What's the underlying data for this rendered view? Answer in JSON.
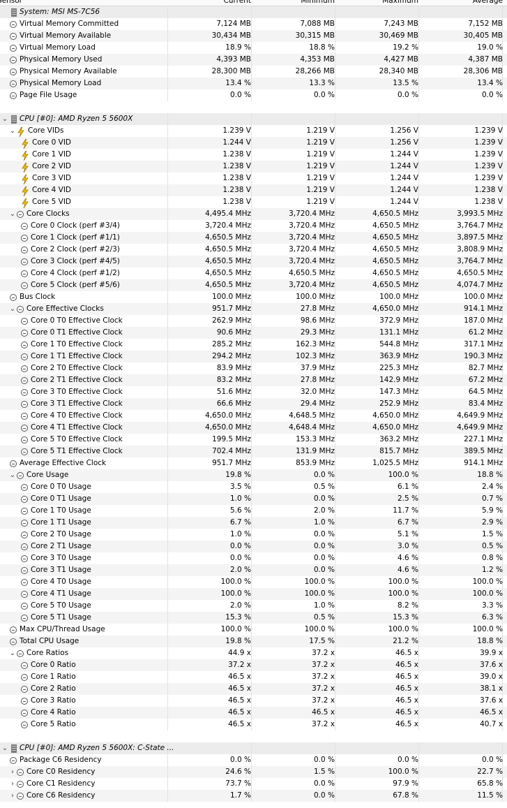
{
  "header": {
    "col_sensor": "Sensor",
    "col_current": "Current",
    "col_minimum": "Minimum",
    "col_maximum": "Maximum",
    "col_average": "Average"
  },
  "rows": [
    {
      "type": "group",
      "expander": "",
      "icon": "chip-icon",
      "label": "System: MSI MS-7C56"
    },
    {
      "type": "item",
      "level": 0,
      "expander": "",
      "icon": "clock-icon",
      "label": "Virtual Memory Committed",
      "v": [
        "7,124 MB",
        "7,088 MB",
        "7,243 MB",
        "7,152 MB"
      ]
    },
    {
      "type": "item",
      "level": 0,
      "expander": "",
      "icon": "clock-icon",
      "label": "Virtual Memory Available",
      "v": [
        "30,434 MB",
        "30,315 MB",
        "30,469 MB",
        "30,405 MB"
      ]
    },
    {
      "type": "item",
      "level": 0,
      "expander": "",
      "icon": "clock-icon",
      "label": "Virtual Memory Load",
      "v": [
        "18.9 %",
        "18.8 %",
        "19.2 %",
        "19.0 %"
      ]
    },
    {
      "type": "item",
      "level": 0,
      "expander": "",
      "icon": "clock-icon",
      "label": "Physical Memory Used",
      "v": [
        "4,393 MB",
        "4,353 MB",
        "4,427 MB",
        "4,387 MB"
      ]
    },
    {
      "type": "item",
      "level": 0,
      "expander": "",
      "icon": "clock-icon",
      "label": "Physical Memory Available",
      "v": [
        "28,300 MB",
        "28,266 MB",
        "28,340 MB",
        "28,306 MB"
      ]
    },
    {
      "type": "item",
      "level": 0,
      "expander": "",
      "icon": "clock-icon",
      "label": "Physical Memory Load",
      "v": [
        "13.4 %",
        "13.3 %",
        "13.5 %",
        "13.4 %"
      ]
    },
    {
      "type": "item",
      "level": 0,
      "expander": "",
      "icon": "clock-icon",
      "label": "Page File Usage",
      "v": [
        "0.0 %",
        "0.0 %",
        "0.0 %",
        "0.0 %"
      ]
    },
    {
      "type": "spacer"
    },
    {
      "type": "group",
      "expander": "⌄",
      "icon": "chip-icon",
      "label": "CPU [#0]: AMD Ryzen 5 5600X"
    },
    {
      "type": "item",
      "level": 1,
      "expander": "⌄",
      "icon": "volt-icon",
      "label": "Core VIDs",
      "v": [
        "1.239 V",
        "1.219 V",
        "1.256 V",
        "1.239 V"
      ]
    },
    {
      "type": "item",
      "level": 2,
      "expander": "",
      "icon": "volt-icon",
      "label": "Core 0 VID",
      "v": [
        "1.244 V",
        "1.219 V",
        "1.256 V",
        "1.239 V"
      ]
    },
    {
      "type": "item",
      "level": 2,
      "expander": "",
      "icon": "volt-icon",
      "label": "Core 1 VID",
      "v": [
        "1.238 V",
        "1.219 V",
        "1.244 V",
        "1.239 V"
      ]
    },
    {
      "type": "item",
      "level": 2,
      "expander": "",
      "icon": "volt-icon",
      "label": "Core 2 VID",
      "v": [
        "1.238 V",
        "1.219 V",
        "1.244 V",
        "1.239 V"
      ]
    },
    {
      "type": "item",
      "level": 2,
      "expander": "",
      "icon": "volt-icon",
      "label": "Core 3 VID",
      "v": [
        "1.238 V",
        "1.219 V",
        "1.244 V",
        "1.239 V"
      ]
    },
    {
      "type": "item",
      "level": 2,
      "expander": "",
      "icon": "volt-icon",
      "label": "Core 4 VID",
      "v": [
        "1.238 V",
        "1.219 V",
        "1.244 V",
        "1.238 V"
      ]
    },
    {
      "type": "item",
      "level": 2,
      "expander": "",
      "icon": "volt-icon",
      "label": "Core 5 VID",
      "v": [
        "1.238 V",
        "1.219 V",
        "1.244 V",
        "1.238 V"
      ]
    },
    {
      "type": "item",
      "level": 1,
      "expander": "⌄",
      "icon": "clock-icon",
      "label": "Core Clocks",
      "v": [
        "4,495.4 MHz",
        "3,720.4 MHz",
        "4,650.5 MHz",
        "3,993.5 MHz"
      ]
    },
    {
      "type": "item",
      "level": 2,
      "expander": "",
      "icon": "clock-icon",
      "label": "Core 0 Clock (perf #3/4)",
      "v": [
        "3,720.4 MHz",
        "3,720.4 MHz",
        "4,650.5 MHz",
        "3,764.7 MHz"
      ]
    },
    {
      "type": "item",
      "level": 2,
      "expander": "",
      "icon": "clock-icon",
      "label": "Core 1 Clock (perf #1/1)",
      "v": [
        "4,650.5 MHz",
        "3,720.4 MHz",
        "4,650.5 MHz",
        "3,897.5 MHz"
      ]
    },
    {
      "type": "item",
      "level": 2,
      "expander": "",
      "icon": "clock-icon",
      "label": "Core 2 Clock (perf #2/3)",
      "v": [
        "4,650.5 MHz",
        "3,720.4 MHz",
        "4,650.5 MHz",
        "3,808.9 MHz"
      ]
    },
    {
      "type": "item",
      "level": 2,
      "expander": "",
      "icon": "clock-icon",
      "label": "Core 3 Clock (perf #4/5)",
      "v": [
        "4,650.5 MHz",
        "3,720.4 MHz",
        "4,650.5 MHz",
        "3,764.7 MHz"
      ]
    },
    {
      "type": "item",
      "level": 2,
      "expander": "",
      "icon": "clock-icon",
      "label": "Core 4 Clock (perf #1/2)",
      "v": [
        "4,650.5 MHz",
        "4,650.5 MHz",
        "4,650.5 MHz",
        "4,650.5 MHz"
      ]
    },
    {
      "type": "item",
      "level": 2,
      "expander": "",
      "icon": "clock-icon",
      "label": "Core 5 Clock (perf #5/6)",
      "v": [
        "4,650.5 MHz",
        "3,720.4 MHz",
        "4,650.5 MHz",
        "4,074.7 MHz"
      ]
    },
    {
      "type": "item",
      "level": 0,
      "expander": "",
      "icon": "clock-icon",
      "label": "Bus Clock",
      "v": [
        "100.0 MHz",
        "100.0 MHz",
        "100.0 MHz",
        "100.0 MHz"
      ]
    },
    {
      "type": "item",
      "level": 1,
      "expander": "⌄",
      "icon": "clock-icon",
      "label": "Core Effective Clocks",
      "v": [
        "951.7 MHz",
        "27.8 MHz",
        "4,650.0 MHz",
        "914.1 MHz"
      ]
    },
    {
      "type": "item",
      "level": 2,
      "expander": "",
      "icon": "clock-icon",
      "label": "Core 0 T0 Effective Clock",
      "v": [
        "262.9 MHz",
        "98.6 MHz",
        "372.9 MHz",
        "187.0 MHz"
      ]
    },
    {
      "type": "item",
      "level": 2,
      "expander": "",
      "icon": "clock-icon",
      "label": "Core 0 T1 Effective Clock",
      "v": [
        "90.6 MHz",
        "29.3 MHz",
        "131.1 MHz",
        "61.2 MHz"
      ]
    },
    {
      "type": "item",
      "level": 2,
      "expander": "",
      "icon": "clock-icon",
      "label": "Core 1 T0 Effective Clock",
      "v": [
        "285.2 MHz",
        "162.3 MHz",
        "544.8 MHz",
        "317.1 MHz"
      ]
    },
    {
      "type": "item",
      "level": 2,
      "expander": "",
      "icon": "clock-icon",
      "label": "Core 1 T1 Effective Clock",
      "v": [
        "294.2 MHz",
        "102.3 MHz",
        "363.9 MHz",
        "190.3 MHz"
      ]
    },
    {
      "type": "item",
      "level": 2,
      "expander": "",
      "icon": "clock-icon",
      "label": "Core 2 T0 Effective Clock",
      "v": [
        "83.9 MHz",
        "37.9 MHz",
        "225.3 MHz",
        "82.7 MHz"
      ]
    },
    {
      "type": "item",
      "level": 2,
      "expander": "",
      "icon": "clock-icon",
      "label": "Core 2 T1 Effective Clock",
      "v": [
        "83.2 MHz",
        "27.8 MHz",
        "142.9 MHz",
        "67.2 MHz"
      ]
    },
    {
      "type": "item",
      "level": 2,
      "expander": "",
      "icon": "clock-icon",
      "label": "Core 3 T0 Effective Clock",
      "v": [
        "51.6 MHz",
        "32.0 MHz",
        "147.3 MHz",
        "64.5 MHz"
      ]
    },
    {
      "type": "item",
      "level": 2,
      "expander": "",
      "icon": "clock-icon",
      "label": "Core 3 T1 Effective Clock",
      "v": [
        "66.6 MHz",
        "29.4 MHz",
        "252.9 MHz",
        "83.4 MHz"
      ]
    },
    {
      "type": "item",
      "level": 2,
      "expander": "",
      "icon": "clock-icon",
      "label": "Core 4 T0 Effective Clock",
      "v": [
        "4,650.0 MHz",
        "4,648.5 MHz",
        "4,650.0 MHz",
        "4,649.9 MHz"
      ]
    },
    {
      "type": "item",
      "level": 2,
      "expander": "",
      "icon": "clock-icon",
      "label": "Core 4 T1 Effective Clock",
      "v": [
        "4,650.0 MHz",
        "4,648.4 MHz",
        "4,650.0 MHz",
        "4,649.9 MHz"
      ]
    },
    {
      "type": "item",
      "level": 2,
      "expander": "",
      "icon": "clock-icon",
      "label": "Core 5 T0 Effective Clock",
      "v": [
        "199.5 MHz",
        "153.3 MHz",
        "363.2 MHz",
        "227.1 MHz"
      ]
    },
    {
      "type": "item",
      "level": 2,
      "expander": "",
      "icon": "clock-icon",
      "label": "Core 5 T1 Effective Clock",
      "v": [
        "702.4 MHz",
        "131.9 MHz",
        "815.7 MHz",
        "389.5 MHz"
      ]
    },
    {
      "type": "item",
      "level": 0,
      "expander": "",
      "icon": "clock-icon",
      "label": "Average Effective Clock",
      "v": [
        "951.7 MHz",
        "853.9 MHz",
        "1,025.5 MHz",
        "914.1 MHz"
      ]
    },
    {
      "type": "item",
      "level": 1,
      "expander": "⌄",
      "icon": "clock-icon",
      "label": "Core Usage",
      "v": [
        "19.8 %",
        "0.0 %",
        "100.0 %",
        "18.8 %"
      ]
    },
    {
      "type": "item",
      "level": 2,
      "expander": "",
      "icon": "clock-icon",
      "label": "Core 0 T0 Usage",
      "v": [
        "3.5 %",
        "0.5 %",
        "6.1 %",
        "2.4 %"
      ]
    },
    {
      "type": "item",
      "level": 2,
      "expander": "",
      "icon": "clock-icon",
      "label": "Core 0 T1 Usage",
      "v": [
        "1.0 %",
        "0.0 %",
        "2.5 %",
        "0.7 %"
      ]
    },
    {
      "type": "item",
      "level": 2,
      "expander": "",
      "icon": "clock-icon",
      "label": "Core 1 T0 Usage",
      "v": [
        "5.6 %",
        "2.0 %",
        "11.7 %",
        "5.9 %"
      ]
    },
    {
      "type": "item",
      "level": 2,
      "expander": "",
      "icon": "clock-icon",
      "label": "Core 1 T1 Usage",
      "v": [
        "6.7 %",
        "1.0 %",
        "6.7 %",
        "2.9 %"
      ]
    },
    {
      "type": "item",
      "level": 2,
      "expander": "",
      "icon": "clock-icon",
      "label": "Core 2 T0 Usage",
      "v": [
        "1.0 %",
        "0.0 %",
        "5.1 %",
        "1.5 %"
      ]
    },
    {
      "type": "item",
      "level": 2,
      "expander": "",
      "icon": "clock-icon",
      "label": "Core 2 T1 Usage",
      "v": [
        "0.0 %",
        "0.0 %",
        "3.0 %",
        "0.5 %"
      ]
    },
    {
      "type": "item",
      "level": 2,
      "expander": "",
      "icon": "clock-icon",
      "label": "Core 3 T0 Usage",
      "v": [
        "0.0 %",
        "0.0 %",
        "4.6 %",
        "0.8 %"
      ]
    },
    {
      "type": "item",
      "level": 2,
      "expander": "",
      "icon": "clock-icon",
      "label": "Core 3 T1 Usage",
      "v": [
        "2.0 %",
        "0.0 %",
        "4.6 %",
        "1.2 %"
      ]
    },
    {
      "type": "item",
      "level": 2,
      "expander": "",
      "icon": "clock-icon",
      "label": "Core 4 T0 Usage",
      "v": [
        "100.0 %",
        "100.0 %",
        "100.0 %",
        "100.0 %"
      ]
    },
    {
      "type": "item",
      "level": 2,
      "expander": "",
      "icon": "clock-icon",
      "label": "Core 4 T1 Usage",
      "v": [
        "100.0 %",
        "100.0 %",
        "100.0 %",
        "100.0 %"
      ]
    },
    {
      "type": "item",
      "level": 2,
      "expander": "",
      "icon": "clock-icon",
      "label": "Core 5 T0 Usage",
      "v": [
        "2.0 %",
        "1.0 %",
        "8.2 %",
        "3.3 %"
      ]
    },
    {
      "type": "item",
      "level": 2,
      "expander": "",
      "icon": "clock-icon",
      "label": "Core 5 T1 Usage",
      "v": [
        "15.3 %",
        "0.5 %",
        "15.3 %",
        "6.3 %"
      ]
    },
    {
      "type": "item",
      "level": 0,
      "expander": "",
      "icon": "clock-icon",
      "label": "Max CPU/Thread Usage",
      "v": [
        "100.0 %",
        "100.0 %",
        "100.0 %",
        "100.0 %"
      ]
    },
    {
      "type": "item",
      "level": 0,
      "expander": "",
      "icon": "clock-icon",
      "label": "Total CPU Usage",
      "v": [
        "19.8 %",
        "17.5 %",
        "21.2 %",
        "18.8 %"
      ]
    },
    {
      "type": "item",
      "level": 1,
      "expander": "⌄",
      "icon": "clock-icon",
      "label": "Core Ratios",
      "v": [
        "44.9 x",
        "37.2 x",
        "46.5 x",
        "39.9 x"
      ]
    },
    {
      "type": "item",
      "level": 2,
      "expander": "",
      "icon": "clock-icon",
      "label": "Core 0 Ratio",
      "v": [
        "37.2 x",
        "37.2 x",
        "46.5 x",
        "37.6 x"
      ]
    },
    {
      "type": "item",
      "level": 2,
      "expander": "",
      "icon": "clock-icon",
      "label": "Core 1 Ratio",
      "v": [
        "46.5 x",
        "37.2 x",
        "46.5 x",
        "39.0 x"
      ]
    },
    {
      "type": "item",
      "level": 2,
      "expander": "",
      "icon": "clock-icon",
      "label": "Core 2 Ratio",
      "v": [
        "46.5 x",
        "37.2 x",
        "46.5 x",
        "38.1 x"
      ]
    },
    {
      "type": "item",
      "level": 2,
      "expander": "",
      "icon": "clock-icon",
      "label": "Core 3 Ratio",
      "v": [
        "46.5 x",
        "37.2 x",
        "46.5 x",
        "37.6 x"
      ]
    },
    {
      "type": "item",
      "level": 2,
      "expander": "",
      "icon": "clock-icon",
      "label": "Core 4 Ratio",
      "v": [
        "46.5 x",
        "46.5 x",
        "46.5 x",
        "46.5 x"
      ]
    },
    {
      "type": "item",
      "level": 2,
      "expander": "",
      "icon": "clock-icon",
      "label": "Core 5 Ratio",
      "v": [
        "46.5 x",
        "37.2 x",
        "46.5 x",
        "40.7 x"
      ]
    },
    {
      "type": "spacer"
    },
    {
      "type": "group",
      "expander": "⌄",
      "icon": "chip-icon",
      "label": "CPU [#0]: AMD Ryzen 5 5600X: C-State ..."
    },
    {
      "type": "item",
      "level": 0,
      "expander": "",
      "icon": "clock-icon",
      "label": "Package C6 Residency",
      "v": [
        "0.0 %",
        "0.0 %",
        "0.0 %",
        "0.0 %"
      ]
    },
    {
      "type": "item",
      "level": 1,
      "expander": "›",
      "icon": "clock-icon",
      "label": "Core C0 Residency",
      "v": [
        "24.6 %",
        "1.5 %",
        "100.0 %",
        "22.7 %"
      ]
    },
    {
      "type": "item",
      "level": 1,
      "expander": "›",
      "icon": "clock-icon",
      "label": "Core C1 Residency",
      "v": [
        "73.7 %",
        "0.0 %",
        "97.9 %",
        "65.8 %"
      ]
    },
    {
      "type": "item",
      "level": 1,
      "expander": "›",
      "icon": "clock-icon",
      "label": "Core C6 Residency",
      "v": [
        "1.7 %",
        "0.0 %",
        "67.8 %",
        "11.5 %"
      ]
    }
  ]
}
